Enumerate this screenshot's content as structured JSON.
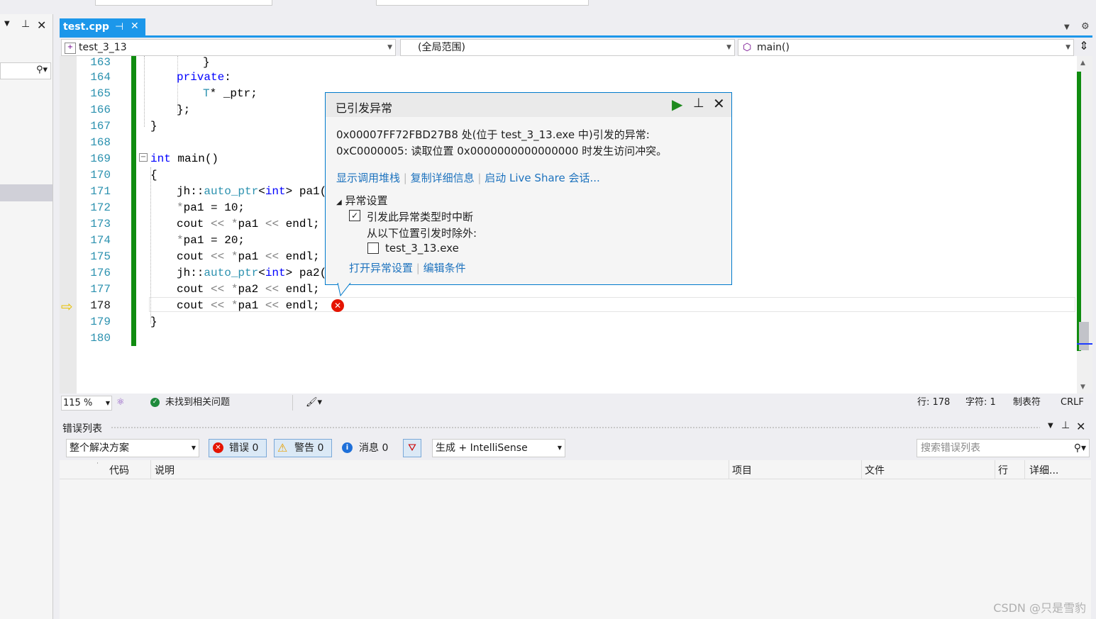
{
  "tab": {
    "title": "test.cpp",
    "pin_glyph": "⊣",
    "close_glyph": "✕"
  },
  "nav": {
    "project": "test_3_13",
    "scope": "(全局范围)",
    "member": "main()"
  },
  "editor": {
    "line_numbers": [
      "163",
      "164",
      "165",
      "166",
      "167",
      "168",
      "169",
      "170",
      "171",
      "172",
      "173",
      "174",
      "175",
      "176",
      "177",
      "178",
      "179",
      "180"
    ],
    "current_line": "178"
  },
  "popup": {
    "title": "已引发异常",
    "message_line1": "0x00007FF72FBD27B8 处(位于 test_3_13.exe 中)引发的异常:",
    "message_line2": "0xC0000005: 读取位置 0x0000000000000000 时发生访问冲突。",
    "link_callstack": "显示调用堆栈",
    "link_copy": "复制详细信息",
    "link_liveshare": "启动 Live Share 会话...",
    "section_title": "异常设置",
    "check_break_label": "引发此异常类型时中断",
    "except_label": "从以下位置引发时除外:",
    "check_exe_label": "test_3_13.exe",
    "link_open_settings": "打开异常设置",
    "link_edit_conditions": "编辑条件",
    "check_break_checked": true,
    "check_exe_checked": false
  },
  "status": {
    "zoom": "115 %",
    "issues": "未找到相关问题",
    "line": "行: 178",
    "char": "字符: 1",
    "tabs": "制表符",
    "eol": "CRLF"
  },
  "errorlist": {
    "title": "错误列表",
    "scope": "整个解决方案",
    "errors": "错误 0",
    "warnings": "警告 0",
    "messages": "消息 0",
    "build": "生成 + IntelliSense",
    "search_placeholder": "搜索错误列表",
    "columns": {
      "code": "代码",
      "desc": "说明",
      "project": "项目",
      "file": "文件",
      "line": "行",
      "detail": "详细..."
    }
  },
  "watermark": "CSDN @只是雪豹",
  "colors": {
    "accent": "#1c97ea",
    "green_bar": "#108c10",
    "error_red": "#e51400",
    "link": "#1e73be"
  },
  "icons": [
    "search-icon",
    "pin-icon",
    "close-icon",
    "continue-icon",
    "error-icon",
    "warning-icon",
    "info-icon",
    "filter-icon",
    "checkmark-icon",
    "current-line-arrow-icon"
  ]
}
